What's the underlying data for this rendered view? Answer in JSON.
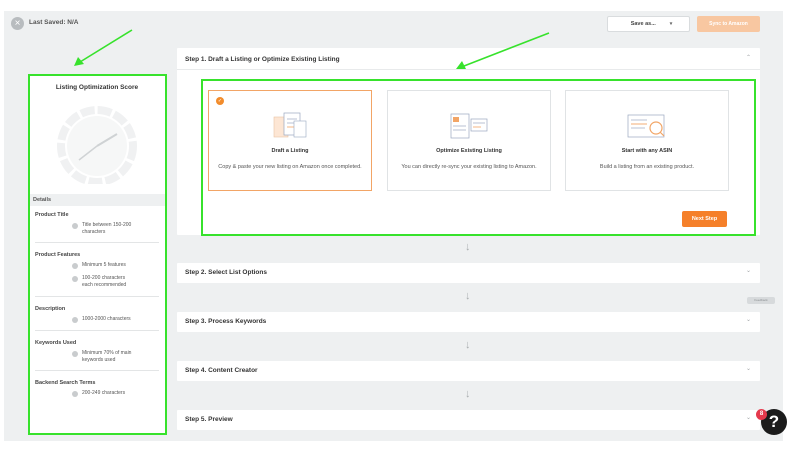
{
  "topbar": {
    "close_glyph": "×",
    "last_saved": "Last Saved: N/A",
    "save_label": "Save as...",
    "sync_label": "Sync to Amazon"
  },
  "score_panel": {
    "title": "Listing Optimization Score",
    "details_label": "Details",
    "sections": [
      {
        "title": "Product Title",
        "criteria": [
          [
            "Title between 150-200",
            "characters"
          ]
        ]
      },
      {
        "title": "Product Features",
        "criteria": [
          [
            "Minimum 5 features"
          ],
          [
            "100-200 characters",
            "each recommended"
          ]
        ]
      },
      {
        "title": "Description",
        "criteria": [
          [
            "1000-2000 characters"
          ]
        ]
      },
      {
        "title": "Keywords Used",
        "criteria": [
          [
            "Minimum 70% of main",
            "keywords used"
          ]
        ]
      },
      {
        "title": "Backend Search Terms",
        "criteria": [
          [
            "200-249 characters"
          ]
        ]
      }
    ]
  },
  "steps": [
    {
      "label": "Step 1. Draft a Listing or Optimize Existing Listing",
      "expanded": true
    },
    {
      "label": "Step 2. Select List Options"
    },
    {
      "label": "Step 3. Process Keywords"
    },
    {
      "label": "Step 4. Content Creator"
    },
    {
      "label": "Step 5. Preview"
    }
  ],
  "step_chevron": "⌄",
  "arrow_glyph": "↓",
  "cards": [
    {
      "title": "Draft a Listing",
      "desc": "Copy & paste your new listing on Amazon once completed.",
      "selected": true
    },
    {
      "title": "Optimize Existing Listing",
      "desc": "You can directly re-sync your existing listing to Amazon."
    },
    {
      "title": "Start with any ASIN",
      "desc": "Build a listing from an existing product."
    }
  ],
  "check_glyph": "✓",
  "next_step_label": "Next Step",
  "side_tag": "Feedback",
  "help": {
    "glyph": "?",
    "badge": "8"
  },
  "colors": {
    "accent_orange": "#f5802a",
    "annotation_green": "#37e22c",
    "background": "#eef0f1"
  }
}
